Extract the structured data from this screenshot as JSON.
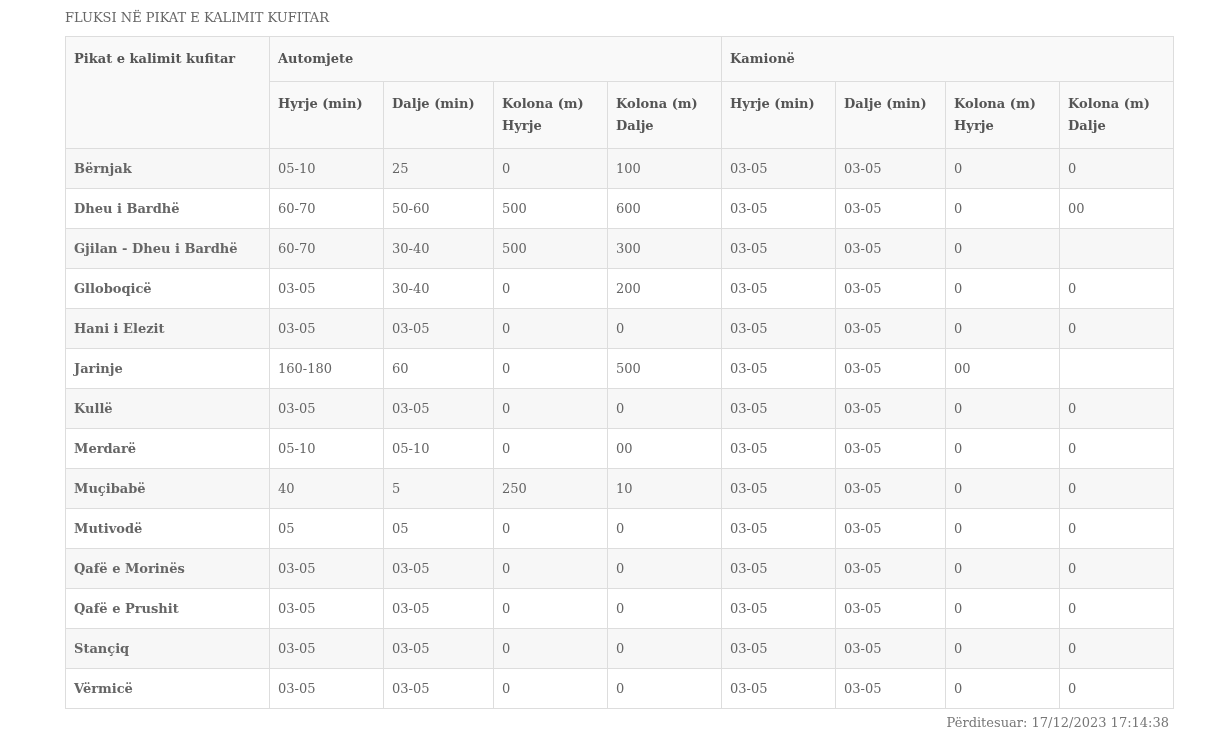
{
  "title": "FLUKSI NË PIKAT E KALIMIT KUFITAR",
  "table": {
    "row_header": "Pikat e kalimit kufitar",
    "groups": [
      {
        "label": "Automjete",
        "columns": [
          "Hyrje (min)",
          "Dalje (min)",
          "Kolona (m) Hyrje",
          "Kolona (m) Dalje"
        ]
      },
      {
        "label": "Kamionë",
        "columns": [
          "Hyrje (min)",
          "Dalje (min)",
          "Kolona (m) Hyrje",
          "Kolona (m) Dalje"
        ]
      }
    ],
    "rows": [
      {
        "name": "Bërnjak",
        "cells": [
          "05-10",
          "25",
          "0",
          "100",
          "03-05",
          "03-05",
          "0",
          "0"
        ]
      },
      {
        "name": "Dheu i Bardhë",
        "cells": [
          "60-70",
          "50-60",
          "500",
          "600",
          "03-05",
          "03-05",
          "0",
          "00"
        ]
      },
      {
        "name": "Gjilan - Dheu i Bardhë",
        "cells": [
          "60-70",
          "30-40",
          "500",
          "300",
          "03-05",
          "03-05",
          "0",
          null
        ]
      },
      {
        "name": "Glloboqicë",
        "cells": [
          "03-05",
          "30-40",
          "0",
          "200",
          "03-05",
          "03-05",
          "0",
          "0"
        ]
      },
      {
        "name": "Hani i Elezit",
        "cells": [
          "03-05",
          "03-05",
          "0",
          "0",
          "03-05",
          "03-05",
          "0",
          "0"
        ]
      },
      {
        "name": "Jarinje",
        "cells": [
          "160-180",
          "60",
          "0",
          "500",
          "03-05",
          "03-05",
          "00",
          null
        ]
      },
      {
        "name": "Kullë",
        "cells": [
          "03-05",
          "03-05",
          "0",
          "0",
          "03-05",
          "03-05",
          "0",
          "0"
        ]
      },
      {
        "name": "Merdarë",
        "cells": [
          "05-10",
          "05-10",
          "0",
          "00",
          "03-05",
          "03-05",
          "0",
          "0"
        ]
      },
      {
        "name": "Muçibabë",
        "cells": [
          "40",
          "5",
          "250",
          "10",
          "03-05",
          "03-05",
          "0",
          "0"
        ]
      },
      {
        "name": "Mutivodë",
        "cells": [
          "05",
          "05",
          "0",
          "0",
          "03-05",
          "03-05",
          "0",
          "0"
        ]
      },
      {
        "name": "Qafë e Morinës",
        "cells": [
          "03-05",
          "03-05",
          "0",
          "0",
          "03-05",
          "03-05",
          "0",
          "0"
        ]
      },
      {
        "name": "Qafë e Prushit",
        "cells": [
          "03-05",
          "03-05",
          "0",
          "0",
          "03-05",
          "03-05",
          "0",
          "0"
        ]
      },
      {
        "name": "Stançiq",
        "cells": [
          "03-05",
          "03-05",
          "0",
          "0",
          "03-05",
          "03-05",
          "0",
          "0"
        ]
      },
      {
        "name": "Vërmicë",
        "cells": [
          "03-05",
          "03-05",
          "0",
          "0",
          "03-05",
          "03-05",
          "0",
          "0"
        ]
      }
    ]
  },
  "footer": {
    "updated": "Përditesuar: 17/12/2023 17:14:38"
  }
}
